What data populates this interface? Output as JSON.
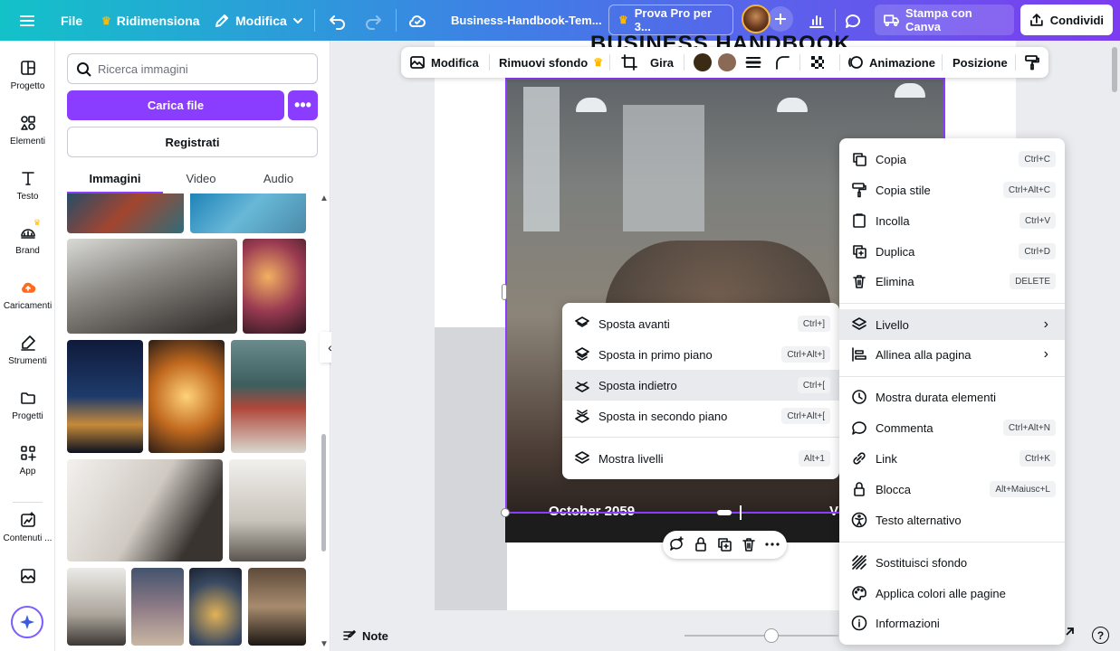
{
  "topbar": {
    "file": "File",
    "resize": "Ridimensiona",
    "edit": "Modifica",
    "doc_title": "Business-Handbook-Tem...",
    "pro": "Prova Pro per 3...",
    "print": "Stampa con Canva",
    "share": "Condividi"
  },
  "rail": [
    {
      "label": "Progetto",
      "icon": "layout-icon"
    },
    {
      "label": "Elementi",
      "icon": "elements-icon"
    },
    {
      "label": "Testo",
      "icon": "text-icon"
    },
    {
      "label": "Brand",
      "icon": "brand-icon"
    },
    {
      "label": "Caricamenti",
      "icon": "cloud-upload-icon"
    },
    {
      "label": "Strumenti",
      "icon": "draw-icon"
    },
    {
      "label": "Progetti",
      "icon": "folder-icon"
    },
    {
      "label": "App",
      "icon": "apps-icon"
    },
    {
      "label": "Contenuti ...",
      "icon": "magic-media-icon"
    }
  ],
  "panel": {
    "search_placeholder": "Ricerca immagini",
    "upload": "Carica file",
    "record": "Registrati",
    "tabs": [
      "Immagini",
      "Video",
      "Audio"
    ]
  },
  "context_toolbar": {
    "edit": "Modifica",
    "bg_remove": "Rimuovi sfondo",
    "flip": "Gira",
    "colors": [
      "#3b2b14",
      "#8a6a55"
    ],
    "animate": "Animazione",
    "position": "Posizione"
  },
  "canvas": {
    "title": "BUSINESS HANDBOOK",
    "date": "October 2059",
    "corner_letter": "V"
  },
  "main_menu": [
    {
      "label": "Copia",
      "kbd": "Ctrl+C",
      "icon": "copy-icon"
    },
    {
      "label": "Copia stile",
      "kbd": "Ctrl+Alt+C",
      "icon": "paint-roller-icon"
    },
    {
      "label": "Incolla",
      "kbd": "Ctrl+V",
      "icon": "clipboard-icon"
    },
    {
      "label": "Duplica",
      "kbd": "Ctrl+D",
      "icon": "duplicate-icon"
    },
    {
      "label": "Elimina",
      "kbd": "DELETE",
      "icon": "trash-icon"
    },
    {
      "label": "Livello",
      "kbd": "",
      "icon": "layers-icon"
    },
    {
      "label": "Allinea alla pagina",
      "kbd": "",
      "icon": "align-icon"
    },
    {
      "label": "Mostra durata elementi",
      "kbd": "",
      "icon": "clock-icon"
    },
    {
      "label": "Commenta",
      "kbd": "Ctrl+Alt+N",
      "icon": "comment-icon"
    },
    {
      "label": "Link",
      "kbd": "Ctrl+K",
      "icon": "link-icon"
    },
    {
      "label": "Blocca",
      "kbd": "Alt+Maiusc+L",
      "icon": "lock-icon"
    },
    {
      "label": "Testo alternativo",
      "kbd": "",
      "icon": "accessibility-icon"
    },
    {
      "label": "Sostituisci sfondo",
      "kbd": "",
      "icon": "hatch-icon"
    },
    {
      "label": "Applica colori alle pagine",
      "kbd": "",
      "icon": "palette-icon"
    },
    {
      "label": "Informazioni",
      "kbd": "",
      "icon": "info-icon"
    }
  ],
  "layer_menu": [
    {
      "label": "Sposta avanti",
      "kbd": "Ctrl+]"
    },
    {
      "label": "Sposta in primo piano",
      "kbd": "Ctrl+Alt+]"
    },
    {
      "label": "Sposta indietro",
      "kbd": "Ctrl+["
    },
    {
      "label": "Sposta in secondo piano",
      "kbd": "Ctrl+Alt+["
    },
    {
      "label": "Mostra livelli",
      "kbd": "Alt+1"
    }
  ],
  "bottom": {
    "notes": "Note"
  },
  "colors": {
    "accent": "#8b3dff"
  }
}
